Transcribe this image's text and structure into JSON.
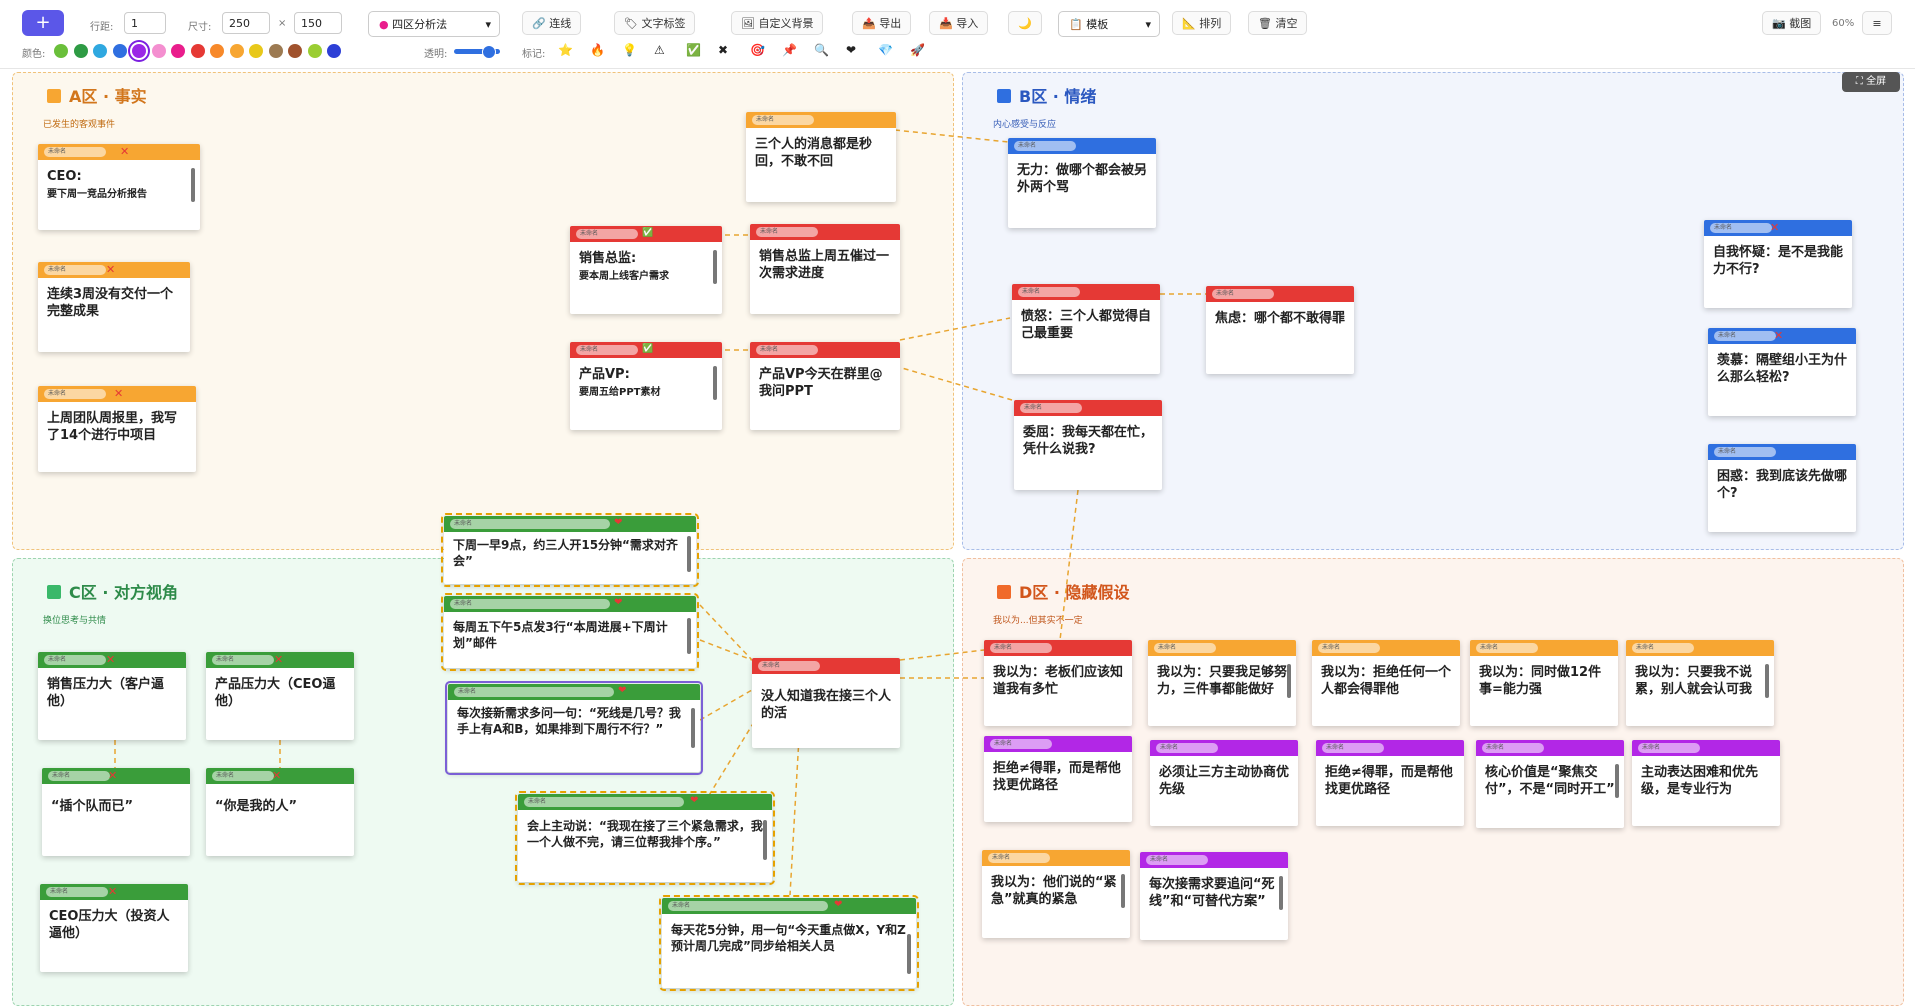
{
  "toolbar": {
    "add_label": "+",
    "rows_label": "行距:",
    "rows_value": "1",
    "size_label": "尺寸:",
    "width_value": "250",
    "times": "×",
    "height_value": "150",
    "mode_select": "四区分析法",
    "connect": "连线",
    "text_tag": "文字标签",
    "custom_bg": "自定义背景",
    "export": "导出",
    "import": "导入",
    "moon": "🌙",
    "template_select": "模板",
    "arrange": "排列",
    "clear": "清空",
    "screenshot": "截图",
    "zoom": "60%",
    "menu_icon": "≡",
    "color_label": "颜色:",
    "opacity_label": "透明:",
    "mark_label": "标记:",
    "colors": [
      "#6abf3a",
      "#2e9b44",
      "#2fa8e0",
      "#2f6fe0",
      "#9b27e6",
      "#f48fd0",
      "#e91e8c",
      "#e53935",
      "#f7892a",
      "#f7a632",
      "#e8c81a",
      "#9c7a52",
      "#a0522d",
      "#9acd32",
      "#2d3fd6"
    ],
    "marks": [
      "⭐",
      "🔥",
      "💡",
      "⚠",
      "✅",
      "✖",
      "🎯",
      "📌",
      "🔍",
      "❤",
      "💎",
      "🚀"
    ]
  },
  "fullscreen": "⛶ 全屏",
  "zones": {
    "a": {
      "title": "A区 · 事实",
      "sub": "已发生的客观事件"
    },
    "b": {
      "title": "B区 · 情绪",
      "sub": "内心感受与反应"
    },
    "c": {
      "title": "C区 · 对方视角",
      "sub": "换位思考与共情"
    },
    "d": {
      "title": "D区 · 隐藏假设",
      "sub": "我以为...但其实不一定"
    }
  },
  "tag": "未命名",
  "notes": {
    "a1": {
      "title": "CEO:",
      "sub": "要下周一竞品分析报告"
    },
    "a2": {
      "text": "连续3周没有交付一个完整成果"
    },
    "a3": {
      "text": "上周团队周报里，我写了14个进行中项目"
    },
    "m1": {
      "text": "三个人的消息都是秒回，不敢不回"
    },
    "m2": {
      "title": "销售总监:",
      "sub": "要本周上线客户需求"
    },
    "m3": {
      "text": "销售总监上周五催过一次需求进度"
    },
    "m4": {
      "title": "产品VP:",
      "sub": "要周五给PPT素材"
    },
    "m5": {
      "text": "产品VP今天在群里@我问PPT"
    },
    "b1": {
      "text": "无力：做哪个都会被另外两个骂"
    },
    "b2": {
      "text": "愤怒：三个人都觉得自己最重要"
    },
    "b3": {
      "text": "焦虑：哪个都不敢得罪"
    },
    "b4": {
      "text": "委屈：我每天都在忙，凭什么说我?"
    },
    "b5": {
      "text": "自我怀疑：是不是我能力不行?"
    },
    "b6": {
      "text": "羡慕：隔壁组小王为什么那么轻松?"
    },
    "b7": {
      "text": "困惑：我到底该先做哪个?"
    },
    "g1": {
      "text": "下周一早9点，约三人开15分钟“需求对齐会”"
    },
    "g2": {
      "text": "每周五下午5点发3行“本周进展+下周计划”邮件"
    },
    "g3": {
      "text": "每次接新需求多问一句：“死线是几号？我手上有A和B，如果排到下周行不行？”"
    },
    "g4": {
      "text": "会上主动说：“我现在接了三个紧急需求，我一个人做不完，请三位帮我排个序。”"
    },
    "g5": {
      "text": "每天花5分钟，用一句“今天重点做X，Y和Z预计周几完成”同步给相关人员"
    },
    "c1": {
      "text": "销售压力大（客户逼他）"
    },
    "c2": {
      "text": "产品压力大（CEO逼他）"
    },
    "c3": {
      "text": "“插个队而已”"
    },
    "c4": {
      "text": "“你是我的人”"
    },
    "c5": {
      "text": "CEO压力大（投资人逼他）"
    },
    "center": {
      "text": "没人知道我在接三个人的活"
    },
    "d1": {
      "text": "我以为：老板们应该知道我有多忙"
    },
    "d2": {
      "text": "我以为：只要我足够努力，三件事都能做好"
    },
    "d3": {
      "text": "我以为：拒绝任何一个人都会得罪他"
    },
    "d4": {
      "text": "我以为：同时做12件事=能力强"
    },
    "d5": {
      "text": "我以为：只要我不说累，别人就会认可我"
    },
    "d6": {
      "text": "拒绝≠得罪，而是帮他找更优路径"
    },
    "d7": {
      "text": "必须让三方主动协商优先级"
    },
    "d8": {
      "text": "拒绝≠得罪，而是帮他找更优路径"
    },
    "d9": {
      "text": "核心价值是“聚焦交付”，不是“同时开工”"
    },
    "d10": {
      "text": "主动表达困难和优先级，是专业行为"
    },
    "d11": {
      "text": "我以为：他们说的“紧急”就真的紧急"
    },
    "d12": {
      "text": "每次接需求要追问“死线”和“可替代方案”"
    }
  }
}
